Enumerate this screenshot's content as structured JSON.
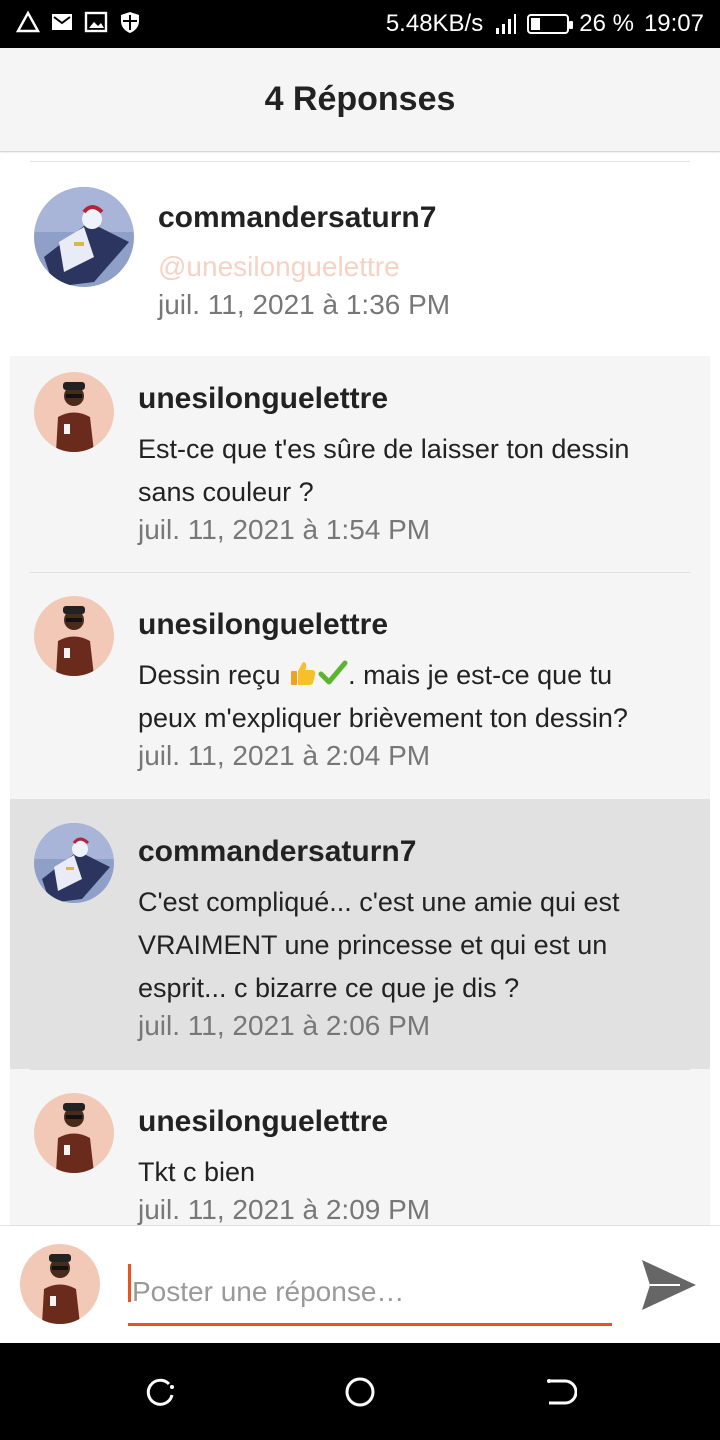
{
  "status_bar": {
    "speed": "5.48KB/s",
    "battery": "26 %",
    "battery_level": 0.26,
    "time": "19:07",
    "icons": [
      "warning-triangle-icon",
      "mail-icon",
      "image-icon",
      "shield-icon",
      "signal-icon",
      "battery-icon"
    ]
  },
  "header": {
    "title": "4 Réponses"
  },
  "original_post": {
    "username": "commandersaturn7",
    "mention": "@unesilonguelettre",
    "timestamp": "juil. 11, 2021 à 1:36 PM"
  },
  "replies": [
    {
      "username": "unesilonguelettre",
      "lines": [
        "Est-ce que t'es sûre de laisser ton dessin",
        "sans couleur ?"
      ],
      "timestamp": "juil. 11, 2021 à 1:54 PM",
      "highlighted": false
    },
    {
      "username": "unesilonguelettre",
      "line1_a": "Dessin reçu ",
      "line1_b": ". mais je est-ce que tu",
      "line2": "peux m'expliquer brièvement ton dessin?",
      "timestamp": "juil. 11, 2021 à 2:04 PM",
      "highlighted": false
    },
    {
      "username": "commandersaturn7",
      "lines": [
        "C'est compliqué... c'est une amie qui est",
        "VRAIMENT une princesse et qui est un",
        "esprit... c bizarre ce que je dis ?"
      ],
      "timestamp": "juil. 11, 2021 à 2:06 PM",
      "highlighted": true
    },
    {
      "username": "unesilonguelettre",
      "lines": [
        "Tkt c bien"
      ],
      "timestamp": "juil. 11, 2021 à 2:09 PM",
      "highlighted": false
    }
  ],
  "composer": {
    "placeholder": "Poster une réponse…",
    "value": ""
  },
  "colors": {
    "accent": "#e8561c",
    "mention": "#f6d2c2",
    "highlight_bg": "#e1e1e1",
    "reply_bg": "#f5f5f5"
  }
}
